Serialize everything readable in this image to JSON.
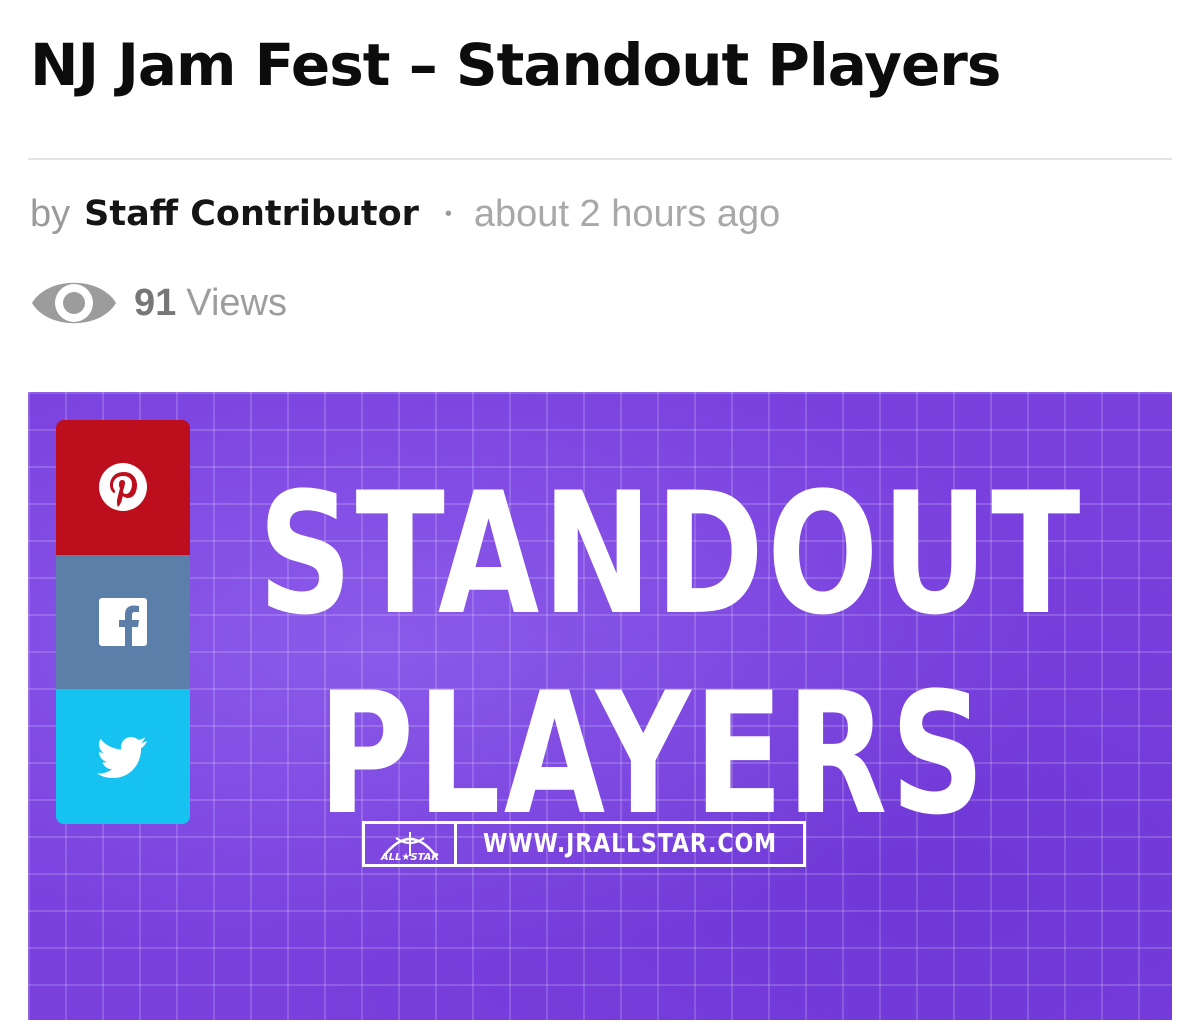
{
  "article": {
    "title": "NJ Jam Fest – Standout Players",
    "byline_prefix": "by",
    "author": "Staff Contributor",
    "separator": "•",
    "time": "about 2 hours ago",
    "views_count": "91",
    "views_label": "Views"
  },
  "hero": {
    "headline_line1": "STANDOUT",
    "headline_line2": "PLAYERS",
    "logo_badge_text": "JR ALL-STAR",
    "url": "WWW.JRALLSTAR.COM",
    "background_color": "#7a40de"
  },
  "share": {
    "buttons": [
      {
        "network": "pinterest",
        "icon": "pinterest-icon",
        "color": "#bd0e1d"
      },
      {
        "network": "facebook",
        "icon": "facebook-icon",
        "color": "#5b7fa9"
      },
      {
        "network": "twitter",
        "icon": "twitter-icon",
        "color": "#16c3f0"
      }
    ]
  },
  "icons": {
    "views": "eye-icon"
  }
}
